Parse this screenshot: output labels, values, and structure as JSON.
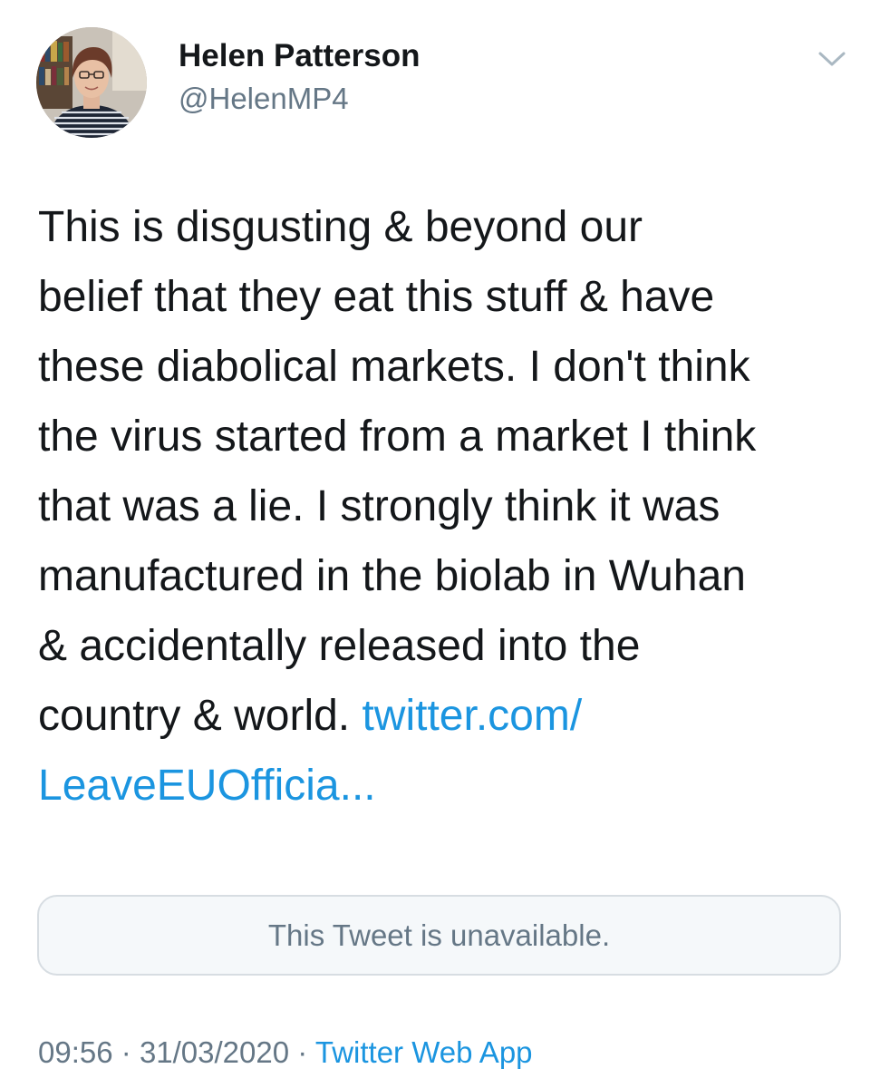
{
  "author": {
    "display_name": "Helen Patterson",
    "handle": "@HelenMP4"
  },
  "tweet": {
    "lines": [
      "This is disgusting & beyond our",
      "belief that they eat this stuff & have",
      "these diabolical markets. I don't think",
      "the virus started from a market I think",
      "that was a lie. I strongly think it was",
      "manufactured in the biolab in Wuhan",
      "& accidentally released into the",
      "country & world. "
    ],
    "link_part1": "twitter.com/",
    "link_part2": "LeaveEUOfficia..."
  },
  "quoted_tweet": {
    "status": "This Tweet is unavailable."
  },
  "meta": {
    "time": "09:56",
    "separator": "·",
    "date": "31/03/2020",
    "source": "Twitter Web App"
  },
  "colors": {
    "link": "#1b95e0",
    "secondary_text": "#657786",
    "card_border": "#d7dde2",
    "card_background": "#f5f8fa"
  },
  "icons": {
    "menu": "chevron-down-icon",
    "avatar": "profile-photo"
  }
}
